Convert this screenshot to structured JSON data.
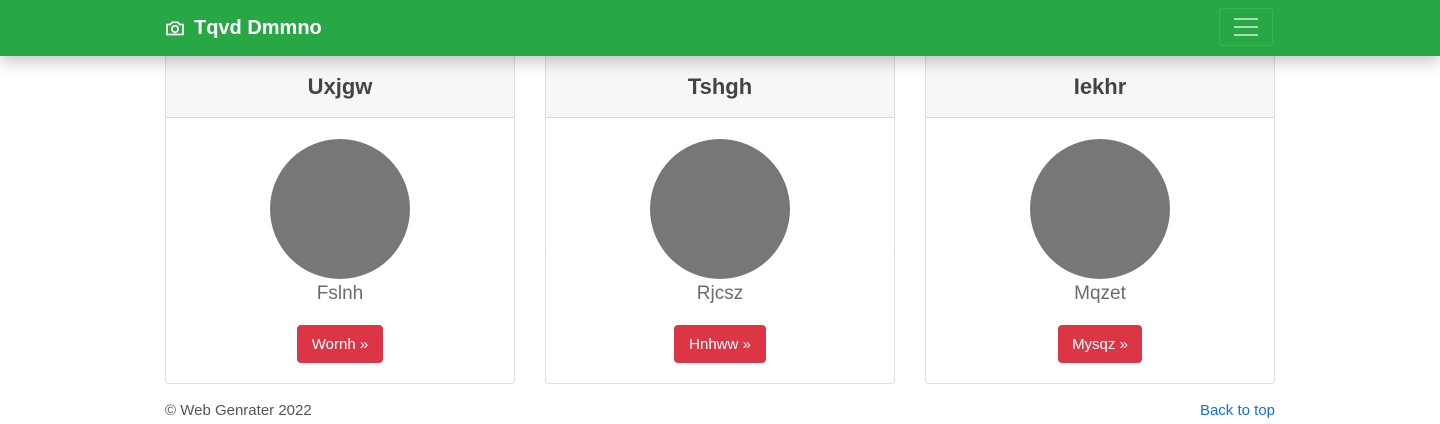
{
  "navbar": {
    "brand": "Tqvd Dmmno",
    "brand_icon": "camera-icon",
    "toggle_icon": "hamburger-icon",
    "bg_color": "#28a745"
  },
  "cards": [
    {
      "title": "Uxjgw",
      "name": "Fslnh",
      "button_label": "Wornh »"
    },
    {
      "title": "Tshgh",
      "name": "Rjcsz",
      "button_label": "Hnhww »"
    },
    {
      "title": "Iekhr",
      "name": "Mqzet",
      "button_label": "Mysqz »"
    }
  ],
  "footer": {
    "copyright": "© Web Genrater 2022",
    "back_to_top": "Back to top"
  },
  "colors": {
    "button": "#dc3545",
    "avatar": "#777777",
    "link": "#0d6efd"
  }
}
